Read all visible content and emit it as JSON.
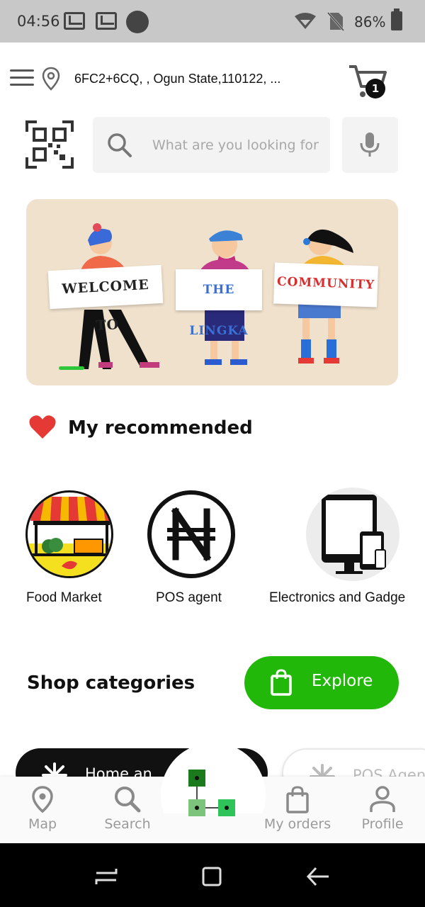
{
  "status_bar": {
    "time": "04:56",
    "battery": "86%"
  },
  "header": {
    "address": "6FC2+6CQ, , Ogun State,110122, ...",
    "cart_count": "1"
  },
  "search": {
    "placeholder": "What are you looking for"
  },
  "banner": {
    "sign1": "WELCOME TO",
    "sign2": "THE LINGKA",
    "sign3": "COMMUNITY"
  },
  "recommended": {
    "title": "My recommended",
    "items": [
      {
        "label": "Food Market",
        "icon": "market-stall-icon"
      },
      {
        "label": "POS agent",
        "icon": "naira-icon"
      },
      {
        "label": "Electronics and Gadge",
        "icon": "devices-icon"
      }
    ]
  },
  "shop": {
    "title": "Shop categories",
    "explore_label": "Explore",
    "categories": [
      {
        "label": "Home an"
      },
      {
        "label": "POS Agen"
      }
    ]
  },
  "bottom_nav": {
    "items": [
      {
        "label": "Map",
        "icon": "map-pin-icon"
      },
      {
        "label": "Search",
        "icon": "search-icon"
      },
      {
        "label": "My orders",
        "icon": "shopping-bag-icon"
      },
      {
        "label": "Profile",
        "icon": "profile-icon"
      }
    ]
  },
  "colors": {
    "accent_green": "#22b80a",
    "banner_bg": "#f0e1cc",
    "heart_red": "#e53935"
  }
}
